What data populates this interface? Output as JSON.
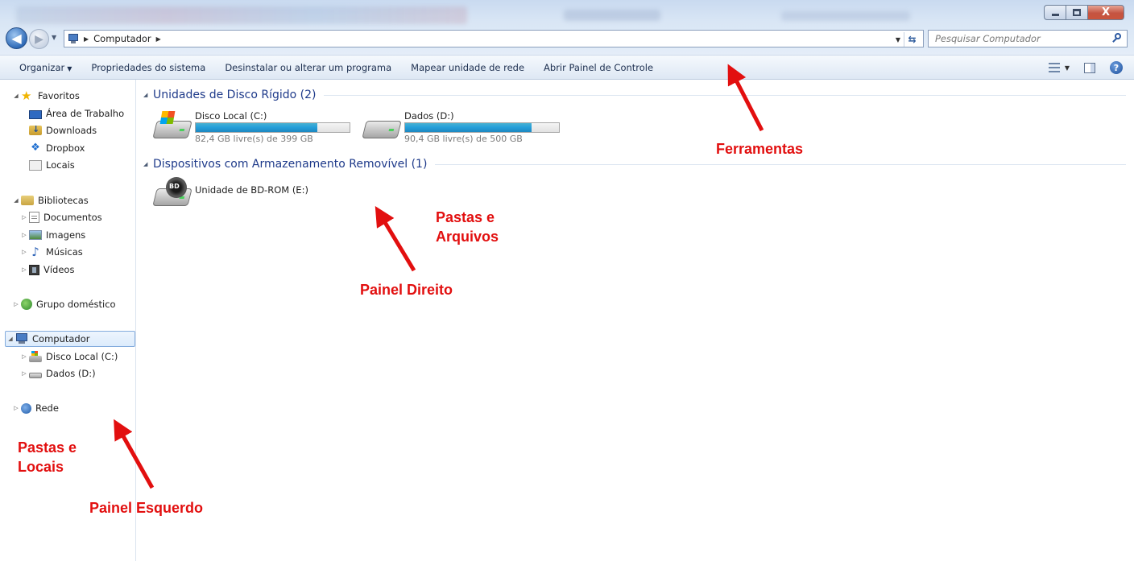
{
  "window": {
    "controls": {
      "minimize": "—",
      "maximize": "□",
      "close": "X"
    }
  },
  "navigation": {
    "back_icon": "back-arrow-icon",
    "forward_icon": "forward-arrow-icon",
    "breadcrumb": [
      "Computador"
    ],
    "search_placeholder": "Pesquisar Computador"
  },
  "toolbar": {
    "items": [
      {
        "label": "Organizar",
        "has_dropdown": true
      },
      {
        "label": "Propriedades do sistema"
      },
      {
        "label": "Desinstalar ou alterar um programa"
      },
      {
        "label": "Mapear unidade de rede"
      },
      {
        "label": "Abrir Painel de Controle"
      }
    ],
    "help_label": "?"
  },
  "sidebar": {
    "favoritos": {
      "label": "Favoritos",
      "items": [
        "Área de Trabalho",
        "Downloads",
        "Dropbox",
        "Locais"
      ]
    },
    "bibliotecas": {
      "label": "Bibliotecas",
      "items": [
        "Documentos",
        "Imagens",
        "Músicas",
        "Vídeos"
      ]
    },
    "grupo": {
      "label": "Grupo doméstico"
    },
    "computador": {
      "label": "Computador",
      "items": [
        "Disco Local (C:)",
        "Dados (D:)"
      ]
    },
    "rede": {
      "label": "Rede"
    }
  },
  "content": {
    "group_hdd": {
      "title": "Unidades de Disco Rígido (2)"
    },
    "group_removable": {
      "title": "Dispositivos com Armazenamento Removível (1)"
    },
    "drives": [
      {
        "name": "Disco Local (C:)",
        "free": "82,4 GB livre(s) de 399 GB",
        "used_fraction": 0.79
      },
      {
        "name": "Dados (D:)",
        "free": "90,4 GB livre(s) de 500 GB",
        "used_fraction": 0.82
      }
    ],
    "removable": [
      {
        "name": "Unidade de BD-ROM (E:)",
        "badge": "BD"
      }
    ]
  },
  "annotations": {
    "ferramentas": "Ferramentas",
    "pastas_arquivos_1": "Pastas e",
    "pastas_arquivos_2": "Arquivos",
    "painel_direito": "Painel Direito",
    "pastas_locais_1": "Pastas e",
    "pastas_locais_2": "Locais",
    "painel_esquerdo": "Painel Esquerdo",
    "color": "#e20f0f"
  }
}
